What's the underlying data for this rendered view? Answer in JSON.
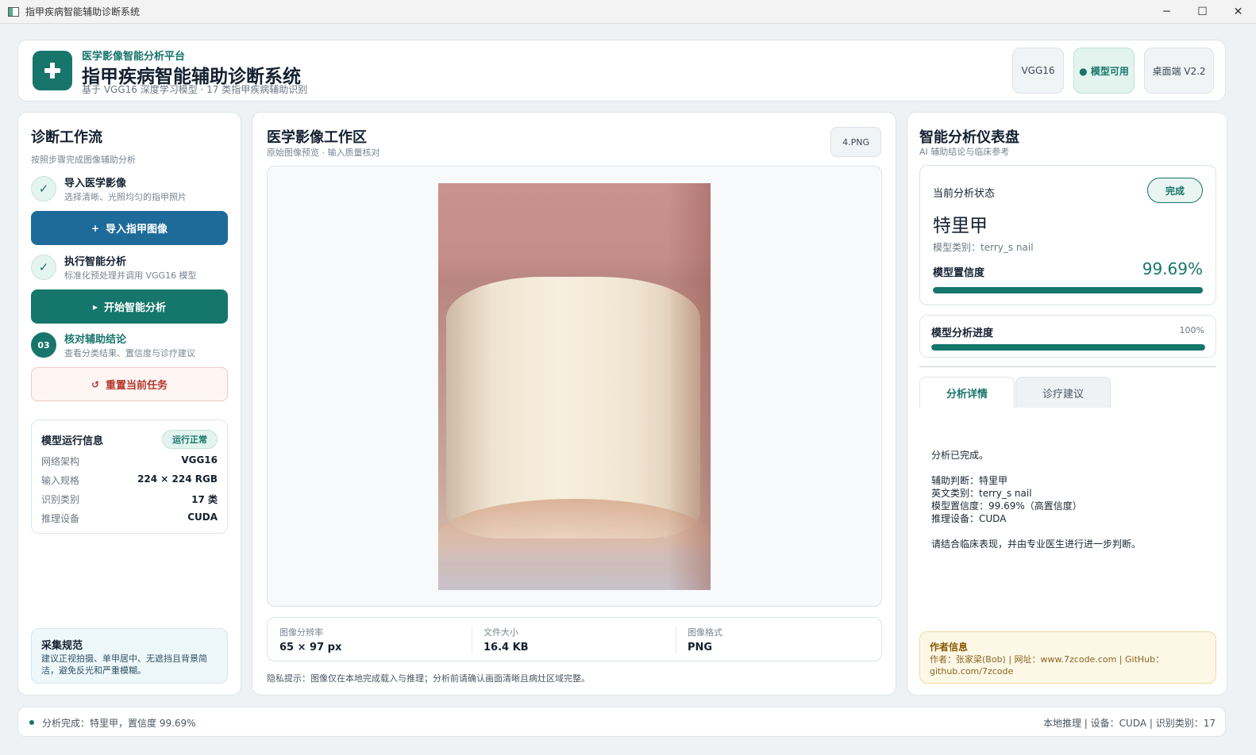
{
  "window": {
    "title": "指甲疾病智能辅助诊断系统",
    "controls": [
      "─",
      "☐",
      "✕"
    ]
  },
  "header": {
    "kicker": "医学影像智能分析平台",
    "title": "指甲疾病智能辅助诊断系统",
    "subtitle": "基于 VGG16 深度学习模型 · 17 类指甲疾病辅助识别",
    "logo_icon": "plus-icon",
    "chips": [
      "VGG16",
      "● 模型可用",
      "桌面端 V2.2"
    ]
  },
  "left": {
    "title": "诊断工作流",
    "subtitle": "按照步骤完成图像辅助分析",
    "steps": [
      {
        "badge": "✓",
        "title": "导入医学影像",
        "desc": "选择清晰、光照均匀的指甲照片"
      },
      {
        "badge": "✓",
        "title": "执行智能分析",
        "desc": "标准化预处理并调用 VGG16 模型"
      },
      {
        "badge": "03",
        "title": "核对辅助结论",
        "desc": "查看分类结果、置信度与诊疗建议"
      }
    ],
    "buttons": {
      "import": {
        "icon": "+",
        "label": "导入指甲图像"
      },
      "analyze": {
        "icon": "▸",
        "label": "开始智能分析"
      },
      "reset": {
        "icon": "↺",
        "label": "重置当前任务"
      }
    },
    "model_info": {
      "title": "模型运行信息",
      "badge": "运行正常",
      "rows": [
        {
          "k": "网络架构",
          "v": "VGG16"
        },
        {
          "k": "输入规格",
          "v": "224 × 224 RGB"
        },
        {
          "k": "识别类别",
          "v": "17 类"
        },
        {
          "k": "推理设备",
          "v": "CUDA"
        }
      ]
    },
    "tips": {
      "title": "采集规范",
      "text": "建议正视拍摄、单甲居中、无遮挡且背景简洁，避免反光和严重模糊。"
    }
  },
  "center": {
    "title": "医学影像工作区",
    "subtitle": "原始图像预览 · 输入质量核对",
    "file_name": "4.PNG",
    "meta": [
      {
        "k": "图像分辨率",
        "v": "65 × 97 px"
      },
      {
        "k": "文件大小",
        "v": "16.4 KB"
      },
      {
        "k": "图像格式",
        "v": "PNG"
      }
    ],
    "privacy": "隐私提示：图像仅在本地完成载入与推理；分析前请确认画面清晰且病灶区域完整。"
  },
  "right": {
    "title": "智能分析仪表盘",
    "subtitle": "AI 辅助结论与临床参考",
    "status": {
      "label": "当前分析状态",
      "badge": "完成",
      "name": "特里甲",
      "class_line": "模型类别：terry_s nail",
      "confidence_label": "模型置信度",
      "confidence_text": "99.69%",
      "confidence_value": 0.9969
    },
    "progress": {
      "label": "模型分析进度",
      "text": "100%",
      "value": 1.0
    },
    "tabs": [
      "分析详情",
      "诊疗建议"
    ],
    "details": [
      "分析已完成。",
      "",
      "辅助判断：特里甲",
      "英文类别：terry_s nail",
      "模型置信度：99.69%（高置信度）",
      "推理设备：CUDA",
      "",
      "请结合临床表现，并由专业医生进行进一步判断。"
    ],
    "author": {
      "title": "作者信息",
      "text": "作者：张家梁(Bob) | 网址：www.7zcode.com | GitHub：github.com/7zcode"
    }
  },
  "statusbar": {
    "left": "分析完成：特里甲，置信度 99.69%",
    "right": "本地推理 | 设备：CUDA | 识别类别：17"
  },
  "colors": {
    "accent": "#17756b",
    "primary_blue": "#1e6b9a",
    "reset_red": "#b3382b"
  }
}
